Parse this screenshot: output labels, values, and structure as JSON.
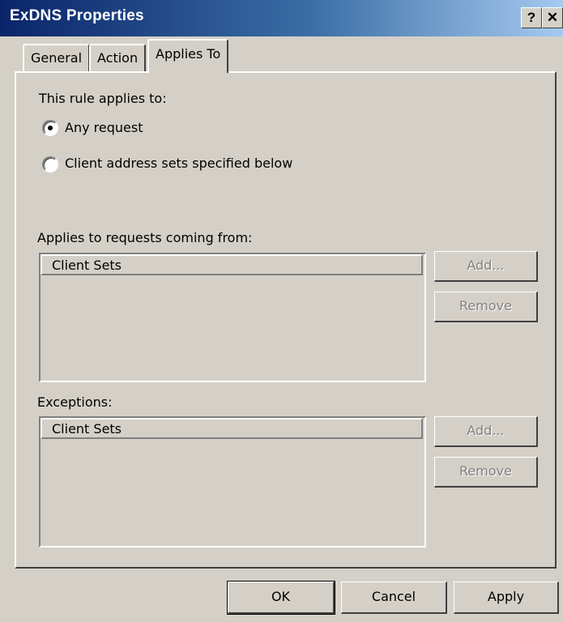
{
  "window": {
    "title": "ExDNS Properties",
    "help_label": "?",
    "close_label": "✕"
  },
  "tabs": [
    {
      "label": "General"
    },
    {
      "label": "Action"
    },
    {
      "label": "Applies To",
      "selected": true
    }
  ],
  "applies_to": {
    "heading": "This rule applies to:",
    "options": [
      {
        "label": "Any request",
        "selected": true
      },
      {
        "label": "Client address sets specified below",
        "selected": false
      }
    ],
    "requests_from": {
      "label": "Applies to requests coming from:",
      "column_header": "Client Sets",
      "rows": [],
      "add_label": "Add...",
      "remove_label": "Remove"
    },
    "exceptions": {
      "label": "Exceptions:",
      "column_header": "Client Sets",
      "rows": [],
      "add_label": "Add...",
      "remove_label": "Remove"
    }
  },
  "footer": {
    "ok_label": "OK",
    "cancel_label": "Cancel",
    "apply_label": "Apply"
  }
}
